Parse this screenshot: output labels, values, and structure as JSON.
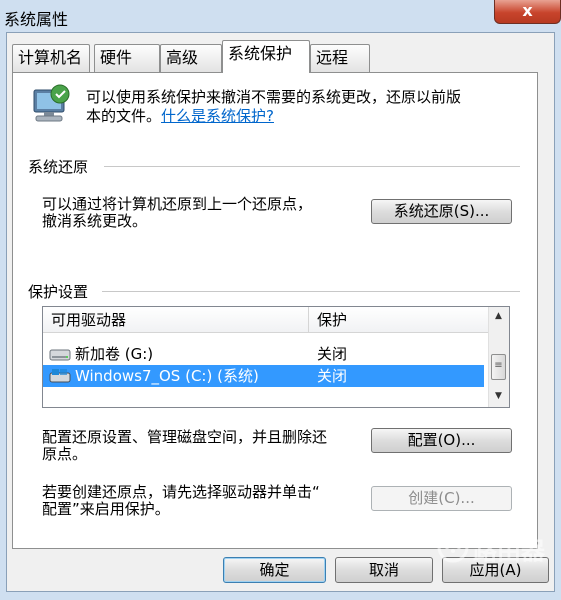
{
  "window": {
    "title": "系统属性",
    "close_glyph": "x"
  },
  "tabs": [
    {
      "label": "计算机名"
    },
    {
      "label": "硬件"
    },
    {
      "label": "高级"
    },
    {
      "label": "系统保护"
    },
    {
      "label": "远程"
    }
  ],
  "intro": {
    "line1": "可以使用系统保护来撤消不需要的系统更改，还原以前版",
    "line2_prefix": "本的文件。",
    "link": "什么是系统保护?"
  },
  "restore": {
    "header": "系统还原",
    "line1": "可以通过将计算机还原到上一个还原点，",
    "line2": "撤消系统更改。",
    "button": "系统还原(S)..."
  },
  "protection": {
    "header": "保护设置",
    "columns": [
      "可用驱动器",
      "保护"
    ],
    "drives": [
      {
        "name": "新加卷 (G:)",
        "status": "关闭"
      },
      {
        "name": "Windows7_OS (C:) (系统)",
        "status": "关闭"
      }
    ],
    "config_line1": "配置还原设置、管理磁盘空间，并且删除还",
    "config_line2": "原点。",
    "config_button": "配置(O)...",
    "create_line1": "若要创建还原点，请先选择驱动器并单击“",
    "create_line2": "配置”来启用保护。",
    "create_button": "创建(C)..."
  },
  "footer": {
    "ok": "确定",
    "cancel": "取消",
    "apply": "应用(A)"
  },
  "watermark": "路由器"
}
